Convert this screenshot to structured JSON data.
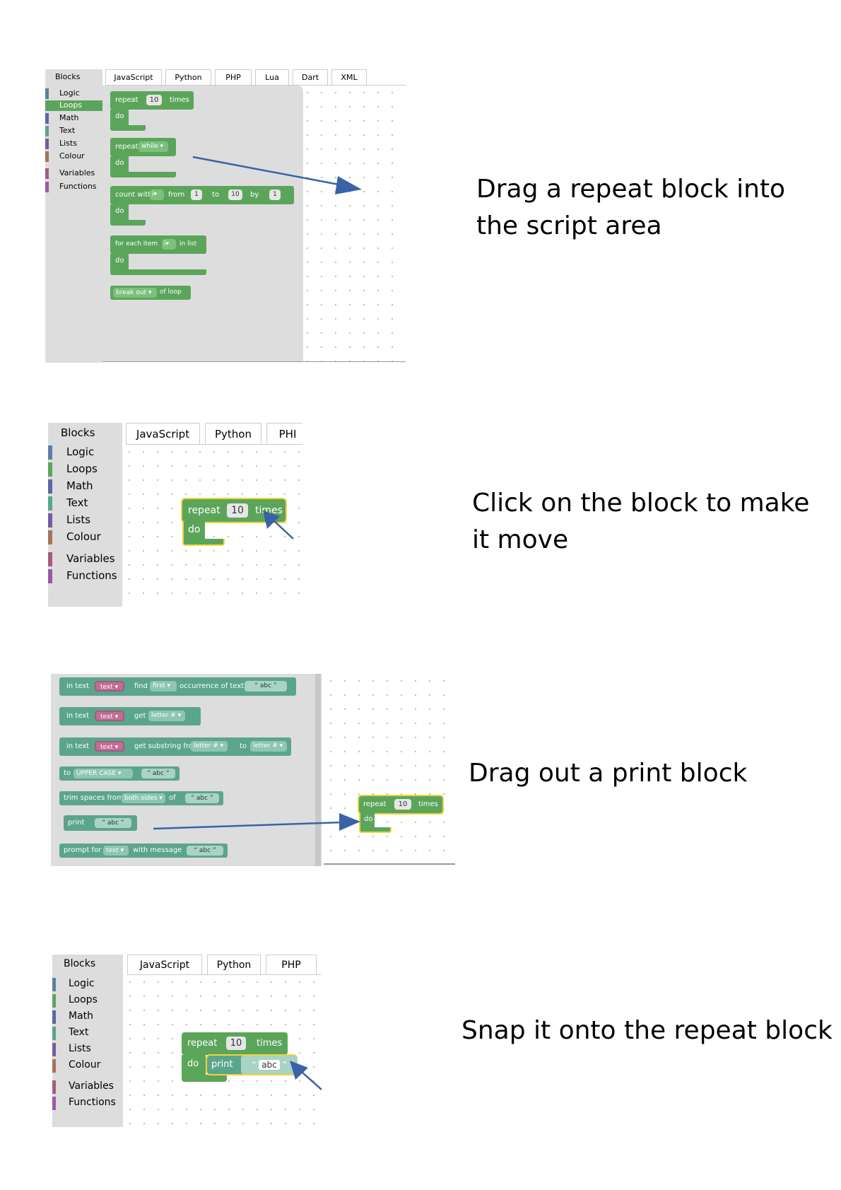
{
  "instructions": [
    "Drag a repeat block into the script area",
    "Click on the block to make it move",
    "Drag out a print block",
    "Snap it onto the repeat block"
  ],
  "categories": [
    {
      "label": "Logic",
      "color": "#5b80a5"
    },
    {
      "label": "Loops",
      "color": "#5ba55b"
    },
    {
      "label": "Math",
      "color": "#5b67a5"
    },
    {
      "label": "Text",
      "color": "#5ba58c"
    },
    {
      "label": "Lists",
      "color": "#745ba5"
    },
    {
      "label": "Colour",
      "color": "#a5745b"
    },
    {
      "label": "Variables",
      "color": "#a55b80"
    },
    {
      "label": "Functions",
      "color": "#995ba5"
    }
  ],
  "toolbox_title": "Blocks",
  "tabs": [
    "JavaScript",
    "Python",
    "PHP",
    "Lua",
    "Dart",
    "XML"
  ],
  "tabs_panel2": [
    "JavaScript",
    "Python",
    "PHI"
  ],
  "loop_blocks": {
    "repeat": "repeat",
    "times": "times",
    "do": "do",
    "ten": "10",
    "while": "while",
    "count_with": "count with",
    "i": "i",
    "from": "from",
    "one": "1",
    "to": "to",
    "by": "by",
    "for_each_item": "for each item",
    "in_list": "in list",
    "break_out": "break out",
    "of_loop": "of loop"
  },
  "text_blocks": {
    "in_text": "in text",
    "text": "text",
    "find": "find",
    "first": "first",
    "occurrence_of_text": "occurrence of text",
    "abc": "abc",
    "get": "get",
    "letter_num": "letter #",
    "get_substring_from": "get substring from",
    "to": "to",
    "to_upper": "to",
    "upper_case": "UPPER CASE",
    "trim_spaces_from": "trim spaces from",
    "both_sides": "both sides",
    "of": "of",
    "print": "print",
    "prompt_for": "prompt for",
    "with_message": "with message",
    "open_quote": "“",
    "close_quote": "”"
  },
  "colors": {
    "loops": "#5ba55b",
    "text": "#5ba58c",
    "selected": "#f2d339",
    "arrow": "#3a62a8",
    "toolbox": "#dddddd"
  }
}
